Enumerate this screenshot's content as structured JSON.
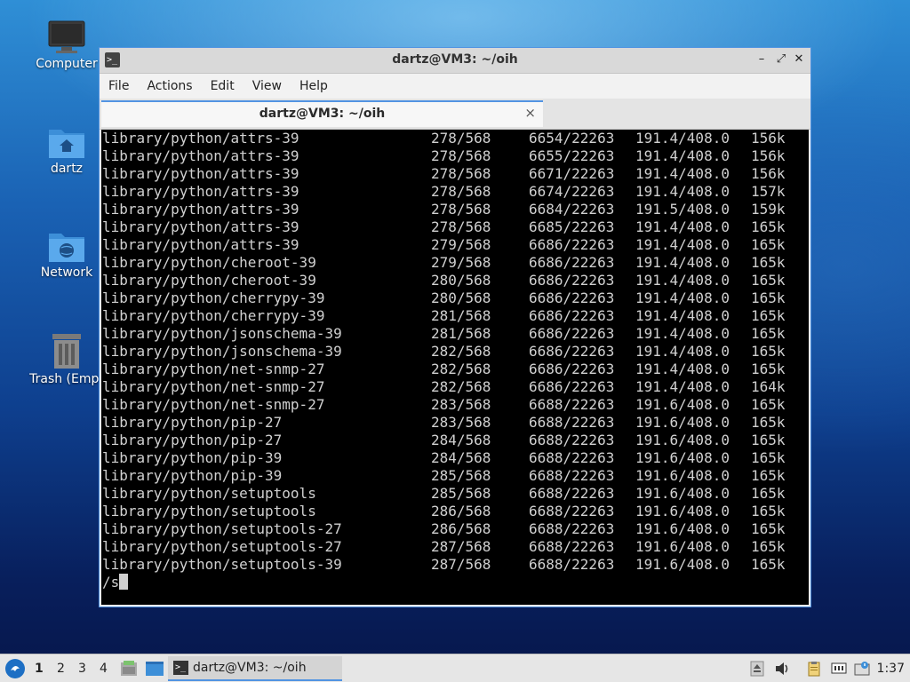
{
  "desktop": {
    "icons": [
      {
        "label": "Computer"
      },
      {
        "label": "dartz"
      },
      {
        "label": "Network"
      },
      {
        "label": "Trash (Empt"
      }
    ]
  },
  "window": {
    "title": "dartz@VM3: ~/oih",
    "menu": [
      "File",
      "Actions",
      "Edit",
      "View",
      "Help"
    ],
    "tab": {
      "title": "dartz@VM3: ~/oih",
      "close": "×"
    },
    "controls": {
      "minimize": "–",
      "maximize": "⤢",
      "close": "✕"
    }
  },
  "terminal": {
    "lines": [
      [
        "library/python/attrs-39",
        "278/568",
        "6654/22263",
        "191.4/408.0",
        "156k"
      ],
      [
        "library/python/attrs-39",
        "278/568",
        "6655/22263",
        "191.4/408.0",
        "156k"
      ],
      [
        "library/python/attrs-39",
        "278/568",
        "6671/22263",
        "191.4/408.0",
        "156k"
      ],
      [
        "library/python/attrs-39",
        "278/568",
        "6674/22263",
        "191.4/408.0",
        "157k"
      ],
      [
        "library/python/attrs-39",
        "278/568",
        "6684/22263",
        "191.5/408.0",
        "159k"
      ],
      [
        "library/python/attrs-39",
        "278/568",
        "6685/22263",
        "191.4/408.0",
        "165k"
      ],
      [
        "library/python/attrs-39",
        "279/568",
        "6686/22263",
        "191.4/408.0",
        "165k"
      ],
      [
        "library/python/cheroot-39",
        "279/568",
        "6686/22263",
        "191.4/408.0",
        "165k"
      ],
      [
        "library/python/cheroot-39",
        "280/568",
        "6686/22263",
        "191.4/408.0",
        "165k"
      ],
      [
        "library/python/cherrypy-39",
        "280/568",
        "6686/22263",
        "191.4/408.0",
        "165k"
      ],
      [
        "library/python/cherrypy-39",
        "281/568",
        "6686/22263",
        "191.4/408.0",
        "165k"
      ],
      [
        "library/python/jsonschema-39",
        "281/568",
        "6686/22263",
        "191.4/408.0",
        "165k"
      ],
      [
        "library/python/jsonschema-39",
        "282/568",
        "6686/22263",
        "191.4/408.0",
        "165k"
      ],
      [
        "library/python/net-snmp-27",
        "282/568",
        "6686/22263",
        "191.4/408.0",
        "165k"
      ],
      [
        "library/python/net-snmp-27",
        "282/568",
        "6686/22263",
        "191.4/408.0",
        "164k"
      ],
      [
        "library/python/net-snmp-27",
        "283/568",
        "6688/22263",
        "191.6/408.0",
        "165k"
      ],
      [
        "library/python/pip-27",
        "283/568",
        "6688/22263",
        "191.6/408.0",
        "165k"
      ],
      [
        "library/python/pip-27",
        "284/568",
        "6688/22263",
        "191.6/408.0",
        "165k"
      ],
      [
        "library/python/pip-39",
        "284/568",
        "6688/22263",
        "191.6/408.0",
        "165k"
      ],
      [
        "library/python/pip-39",
        "285/568",
        "6688/22263",
        "191.6/408.0",
        "165k"
      ],
      [
        "library/python/setuptools",
        "285/568",
        "6688/22263",
        "191.6/408.0",
        "165k"
      ],
      [
        "library/python/setuptools",
        "286/568",
        "6688/22263",
        "191.6/408.0",
        "165k"
      ],
      [
        "library/python/setuptools-27",
        "286/568",
        "6688/22263",
        "191.6/408.0",
        "165k"
      ],
      [
        "library/python/setuptools-27",
        "287/568",
        "6688/22263",
        "191.6/408.0",
        "165k"
      ],
      [
        "library/python/setuptools-39",
        "287/568",
        "6688/22263",
        "191.6/408.0",
        "165k"
      ]
    ],
    "prompt": "/s"
  },
  "taskbar": {
    "workspaces": [
      "1",
      "2",
      "3",
      "4"
    ],
    "task_label": "dartz@VM3: ~/oih",
    "clock": "1:37"
  }
}
